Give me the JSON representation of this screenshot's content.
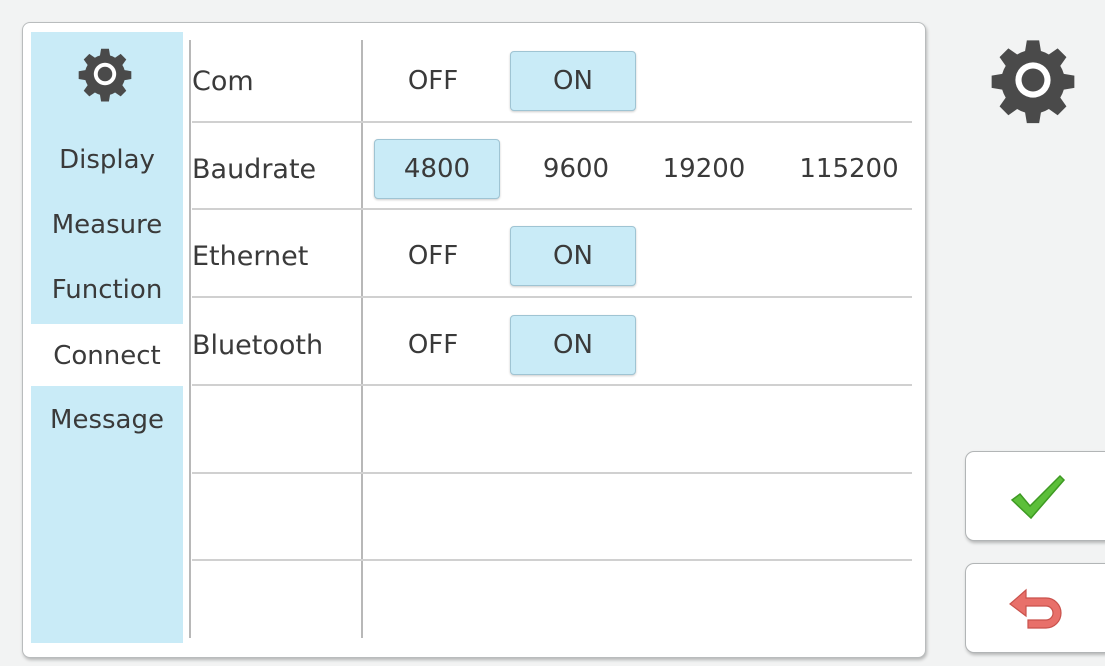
{
  "sidebar": {
    "icon": "gear-icon",
    "items": [
      {
        "label": "Display"
      },
      {
        "label": "Measure"
      },
      {
        "label": "Function"
      },
      {
        "label": "Connect",
        "active": true
      },
      {
        "label": "Message"
      }
    ]
  },
  "settings": {
    "com": {
      "label": "Com",
      "options": [
        "OFF",
        "ON"
      ],
      "selected": "ON"
    },
    "baudrate": {
      "label": "Baudrate",
      "options": [
        "4800",
        "9600",
        "19200",
        "115200"
      ],
      "selected": "4800"
    },
    "ethernet": {
      "label": "Ethernet",
      "options": [
        "OFF",
        "ON"
      ],
      "selected": "ON"
    },
    "bluetooth": {
      "label": "Bluetooth",
      "options": [
        "OFF",
        "ON"
      ],
      "selected": "ON"
    }
  },
  "header_icon": "gear-icon",
  "actions": {
    "confirm_icon": "check-icon",
    "back_icon": "back-arrow-icon"
  },
  "colors": {
    "selected": "#c9ebf7",
    "gear": "#4a4a4a",
    "check": "#5cbf3a",
    "back": "#e8706a"
  }
}
